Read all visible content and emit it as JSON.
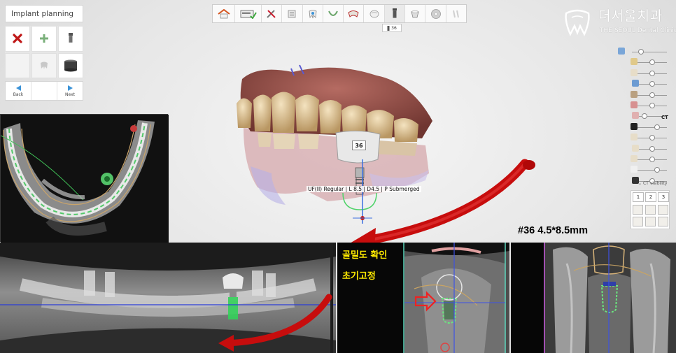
{
  "planning_panel": {
    "title": "Implant planning",
    "back_label": "Back",
    "next_label": "Next"
  },
  "toolbar": {
    "tooltip": "36",
    "icons": [
      "home-icon",
      "checklist-icon",
      "tools-icon",
      "scan-icon",
      "tooth-icon",
      "arch-icon",
      "jaw-icon",
      "crown-icon",
      "implant-icon",
      "abutment-icon",
      "disc-icon",
      "grayed-icon"
    ]
  },
  "logo": {
    "korean": "더서울치과",
    "english": "THE SEOUL Dental Clinic"
  },
  "view_panel": {
    "ct_label": "CT",
    "ct_visibility": "CT visibility",
    "views": [
      "1",
      "2",
      "3"
    ]
  },
  "scene": {
    "tooth_label": "36",
    "implant_label": "UF(II) Regular | L 8.5 | D4.5 | P Submerged",
    "spec": "#36 4.5*8.5mm",
    "annotation_bone": "골밀도 확인",
    "annotation_fixation": "초기고정"
  },
  "sliders": [
    {
      "icon": "pin-icon",
      "value": 0.2
    },
    {
      "icon": "crown-icon",
      "value": 0.55
    },
    {
      "icon": "tooth-icon",
      "value": 0.55
    },
    {
      "icon": "scan-icon",
      "value": 0.55
    },
    {
      "icon": "implant-icon",
      "value": 0.55
    },
    {
      "icon": "gum-icon",
      "value": 0.55
    },
    {
      "icon": "nerve-icon",
      "value": 0.3
    },
    {
      "icon": "ct-icon",
      "value": 0.7
    },
    {
      "icon": "tooth-icon",
      "value": 0.55
    },
    {
      "icon": "tooth-icon",
      "value": 0.55
    },
    {
      "icon": "tooth-icon",
      "value": 0.55
    },
    {
      "icon": "brightness-icon",
      "value": 0.7
    },
    {
      "icon": "contrast-icon",
      "value": 0.55
    }
  ],
  "colors": {
    "accent_blue": "#3b93d8",
    "annotation_yellow": "#ffeb00",
    "implant_green": "#3ddc57",
    "arrow_red": "#d40000"
  }
}
